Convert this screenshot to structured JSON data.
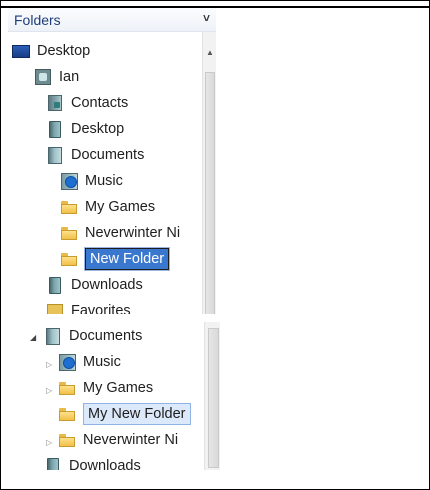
{
  "folders_header": {
    "title": "Folders",
    "chevron": "˅"
  },
  "top_tree": {
    "items": [
      {
        "label": "Desktop",
        "icon": "desktop-icon"
      },
      {
        "label": "Ian",
        "icon": "user-icon"
      },
      {
        "label": "Contacts",
        "icon": "contacts-icon"
      },
      {
        "label": "Desktop",
        "icon": "library-icon"
      },
      {
        "label": "Documents",
        "icon": "documents-icon"
      },
      {
        "label": "Music",
        "icon": "music-icon"
      },
      {
        "label": "My Games",
        "icon": "folder-icon"
      },
      {
        "label": "Neverwinter Ni",
        "icon": "folder-icon"
      },
      {
        "label": "New Folder",
        "icon": "folder-icon",
        "state": "renaming"
      },
      {
        "label": "Downloads",
        "icon": "library-icon"
      },
      {
        "label": "Favorites",
        "icon": "favorites-icon"
      }
    ]
  },
  "bottom_tree": {
    "items": [
      {
        "label": "Documents",
        "icon": "documents-icon",
        "expander": "◢"
      },
      {
        "label": "Music",
        "icon": "music-icon",
        "expander": "▷"
      },
      {
        "label": "My Games",
        "icon": "folder-icon",
        "expander": "▷"
      },
      {
        "label": "My New Folder",
        "icon": "folder-icon",
        "state": "selected"
      },
      {
        "label": "Neverwinter Ni",
        "icon": "folder-icon",
        "expander": "▷"
      },
      {
        "label": "Downloads",
        "icon": "library-icon"
      }
    ]
  },
  "colors": {
    "header_text": "#1e3e7a",
    "rename_bg": "#3a78d0",
    "selected_bg": "#dce9fb",
    "folder": "#f0c04a"
  }
}
